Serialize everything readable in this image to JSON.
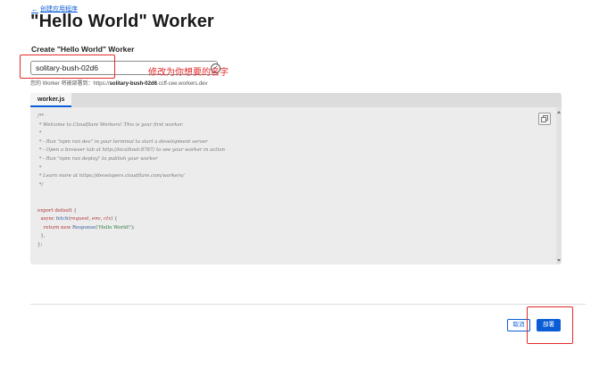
{
  "breadcrumb": {
    "back_arrow": "←",
    "label": "创建应用程序"
  },
  "page": {
    "title": "\"Hello World\" Worker"
  },
  "form": {
    "label": "Create \"Hello World\" Worker",
    "name_value": "solitary-bush-02d6",
    "annotation": "修改为你想要的名字",
    "check_glyph": "✓",
    "deploy_prefix": "您的 Worker 将被部署到：https://",
    "deploy_name": "solitary-bush-02d6",
    "deploy_suffix": ".ccff-cee.workers.dev"
  },
  "editor": {
    "tab_label": "worker.js",
    "copy_icon": "copy-icon",
    "code_lines": [
      "/**",
      " * Welcome to Cloudflare Workers! This is your first worker.",
      " *",
      " * - Run \"npm run dev\" in your terminal to start a development server",
      " * - Open a browser tab at http://localhost:8787/ to see your worker in action",
      " * - Run \"npm run deploy\" to publish your worker",
      " *",
      " * Learn more at https://developers.cloudflare.com/workers/",
      " */",
      "",
      "",
      "export default {",
      "  async fetch(request, env, ctx) {",
      "    return new Response('Hello World!');",
      "  },",
      "};"
    ]
  },
  "footer": {
    "cancel_label": "取消",
    "deploy_label": "部署"
  },
  "colors": {
    "accent": "#0a5dd6",
    "annotation": "#e22a2a"
  }
}
